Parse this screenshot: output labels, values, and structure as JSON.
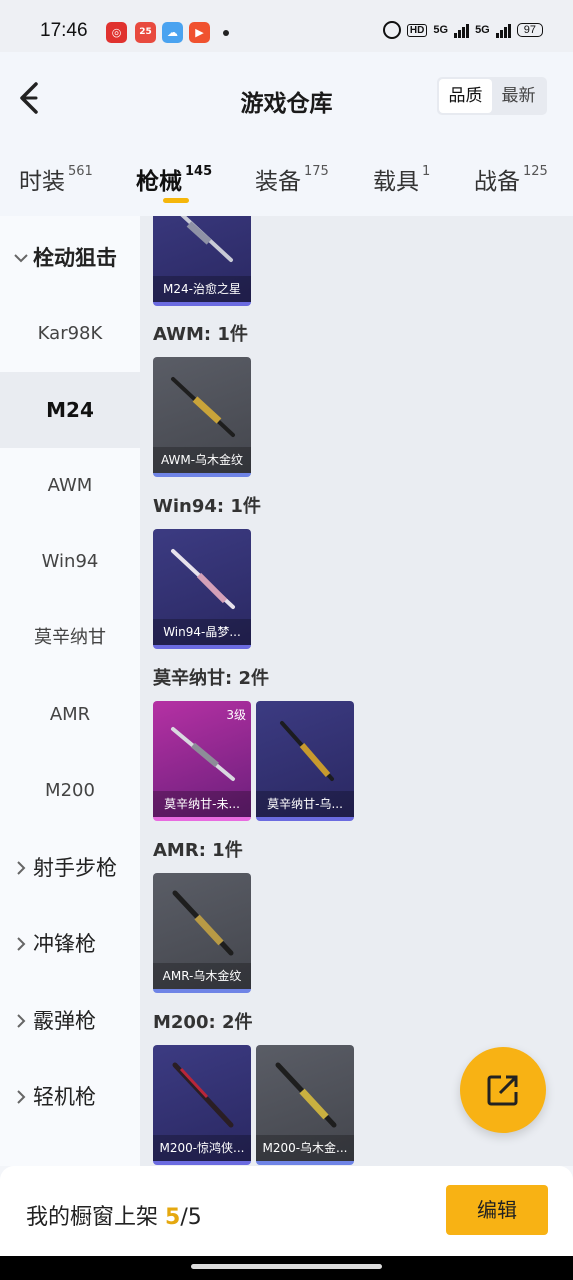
{
  "status_bar": {
    "time": "17:46",
    "app_icons": [
      "网易云",
      "25",
      "天气",
      "视频"
    ],
    "network": "5G",
    "network2": "5G",
    "hd": "HD",
    "battery": "97"
  },
  "header": {
    "title": "游戏仓库",
    "sort_options": [
      "品质",
      "最新"
    ],
    "sort_active": "品质"
  },
  "tabs": [
    {
      "label": "时装",
      "count": "561"
    },
    {
      "label": "枪械",
      "count": "145",
      "active": true
    },
    {
      "label": "装备",
      "count": "175"
    },
    {
      "label": "载具",
      "count": "1"
    },
    {
      "label": "战备",
      "count": "125"
    }
  ],
  "sidebar": {
    "group_open": "栓动狙击",
    "items": [
      "Kar98K",
      "M24",
      "AWM",
      "Win94",
      "莫辛纳甘",
      "AMR",
      "M200"
    ],
    "active_item": "M24",
    "groups_closed": [
      "射手步枪",
      "冲锋枪",
      "霰弹枪",
      "轻机枪"
    ]
  },
  "content": {
    "sections": [
      {
        "title": "",
        "cards": [
          {
            "name": "M24-治愈之星",
            "style": "purple"
          }
        ]
      },
      {
        "title": "AWM: 1件",
        "cards": [
          {
            "name": "AWM-乌木金纹",
            "style": "gray"
          }
        ]
      },
      {
        "title": "Win94: 1件",
        "cards": [
          {
            "name": "Win94-晶梦...",
            "style": "purple"
          }
        ]
      },
      {
        "title": "莫辛纳甘: 2件",
        "cards": [
          {
            "name": "莫辛纳甘-未...",
            "style": "pink",
            "level": "3级"
          },
          {
            "name": "莫辛纳甘-乌...",
            "style": "purple"
          }
        ]
      },
      {
        "title": "AMR: 1件",
        "cards": [
          {
            "name": "AMR-乌木金纹",
            "style": "gray"
          }
        ]
      },
      {
        "title": "M200: 2件",
        "cards": [
          {
            "name": "M200-惊鸿侠...",
            "style": "purple"
          },
          {
            "name": "M200-乌木金...",
            "style": "gray"
          }
        ]
      }
    ]
  },
  "fab": {
    "icon": "share-icon"
  },
  "bottom_bar": {
    "label": "我的橱窗上架",
    "count_current": "5",
    "count_sep": "/",
    "count_total": "5",
    "edit_label": "编辑"
  },
  "colors": {
    "accent": "#f8b214",
    "purple_card": "#2f2d6e",
    "gray_card": "#4e5058",
    "pink_card": "#a42d98"
  }
}
